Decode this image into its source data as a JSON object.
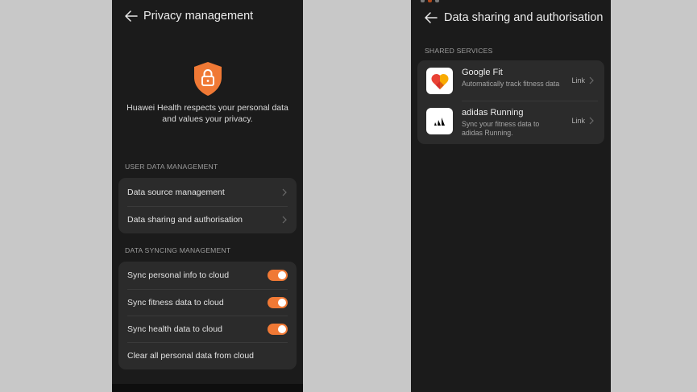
{
  "left": {
    "title": "Privacy management",
    "intro": "Huawei Health respects your personal data and values your privacy.",
    "icons": {
      "back": "arrow-left-icon",
      "hero": "shield-lock-icon",
      "chevron": "chevron-right-icon"
    },
    "sections": {
      "user_data": {
        "label": "USER DATA MANAGEMENT",
        "items": [
          "Data source management",
          "Data sharing and authorisation"
        ]
      },
      "sync": {
        "label": "DATA SYNCING MANAGEMENT",
        "toggles": [
          {
            "label": "Sync personal info to cloud",
            "on": true
          },
          {
            "label": "Sync fitness data to cloud",
            "on": true
          },
          {
            "label": "Sync health data to cloud",
            "on": true
          }
        ],
        "clear_label": "Clear all personal data from cloud"
      }
    }
  },
  "right": {
    "title": "Data sharing and authorisation",
    "section_label": "SHARED SERVICES",
    "services": [
      {
        "name": "Google Fit",
        "desc": "Automatically track fitness data",
        "action": "Link",
        "icon": "google-fit-heart-icon"
      },
      {
        "name": "adidas Running",
        "desc": "Sync your fitness data to adidas Running.",
        "action": "Link",
        "icon": "adidas-running-logo-icon"
      }
    ]
  },
  "colors": {
    "accent": "#f07935",
    "background": "#1b1b1b",
    "card": "#2b2b2b",
    "page": "#c8c8c8"
  }
}
